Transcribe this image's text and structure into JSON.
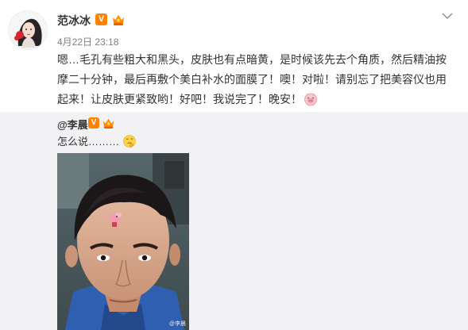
{
  "post": {
    "user_name": "范冰冰",
    "timestamp": "4月22日 23:18",
    "text_lines": [
      "嗯…毛孔有些粗大和黑头，皮肤也有点暗黄，是时候该先去个角质，然后精油按",
      "摩二十分钟，最后再敷个美白补水的面膜了！噢！对啦！请别忘了把美容仪也用",
      "起来！让皮肤更紧致哟！好吧！我说完了！晚安！"
    ]
  },
  "repost": {
    "user_name": "@李晨",
    "text": "怎么说………"
  },
  "icons": {
    "avatar": "avatar-illustration",
    "verified": "verified-v-icon",
    "crown": "vip-crown-icon",
    "more": "chevron-down-icon",
    "pig": "pig-emoji-icon",
    "thinking": "thinking-emoji-icon"
  },
  "colors": {
    "verified": "#ff8200",
    "repost_bg": "#f2f2f5",
    "timestamp": "#808080"
  }
}
